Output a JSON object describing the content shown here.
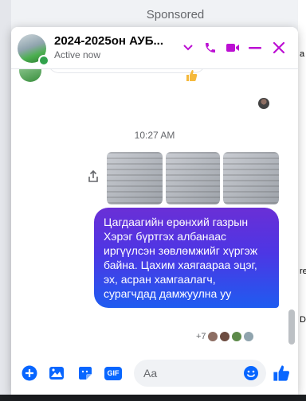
{
  "background": {
    "sponsored_label": "Sponsored",
    "right_fragments": [
      "a",
      "re",
      "D"
    ]
  },
  "chat": {
    "title": "2024-2025он АУБ...",
    "status": "Active now",
    "header_icons": [
      "chevron-down-icon",
      "phone-icon",
      "video-camera-icon",
      "minimize-icon",
      "close-icon"
    ],
    "accent_color": "#bc0fd3",
    "messages": {
      "timestamp": "10:27 AM",
      "photos": [
        "photo-1",
        "photo-2",
        "photo-3"
      ],
      "text": "Цагдаагийн ерөнхий газрын Хэрэг бүртгэх албанаас иргүүлсэн зөвлөмжийг хүргэж байна. Цахим хаягаараа эцэг, эх, асран хамгаалагч, сурагчдад дамжуулна уу",
      "bubble_color": "#4d36e4",
      "reaction_count": "+7"
    },
    "composer": {
      "icons": [
        "plus-circle-icon",
        "image-icon",
        "sticker-icon",
        "gif-icon",
        "emoji-icon",
        "thumbs-up-icon"
      ],
      "gif_label": "GIF",
      "input_placeholder": "Aa",
      "icon_color": "#0866ff"
    }
  }
}
